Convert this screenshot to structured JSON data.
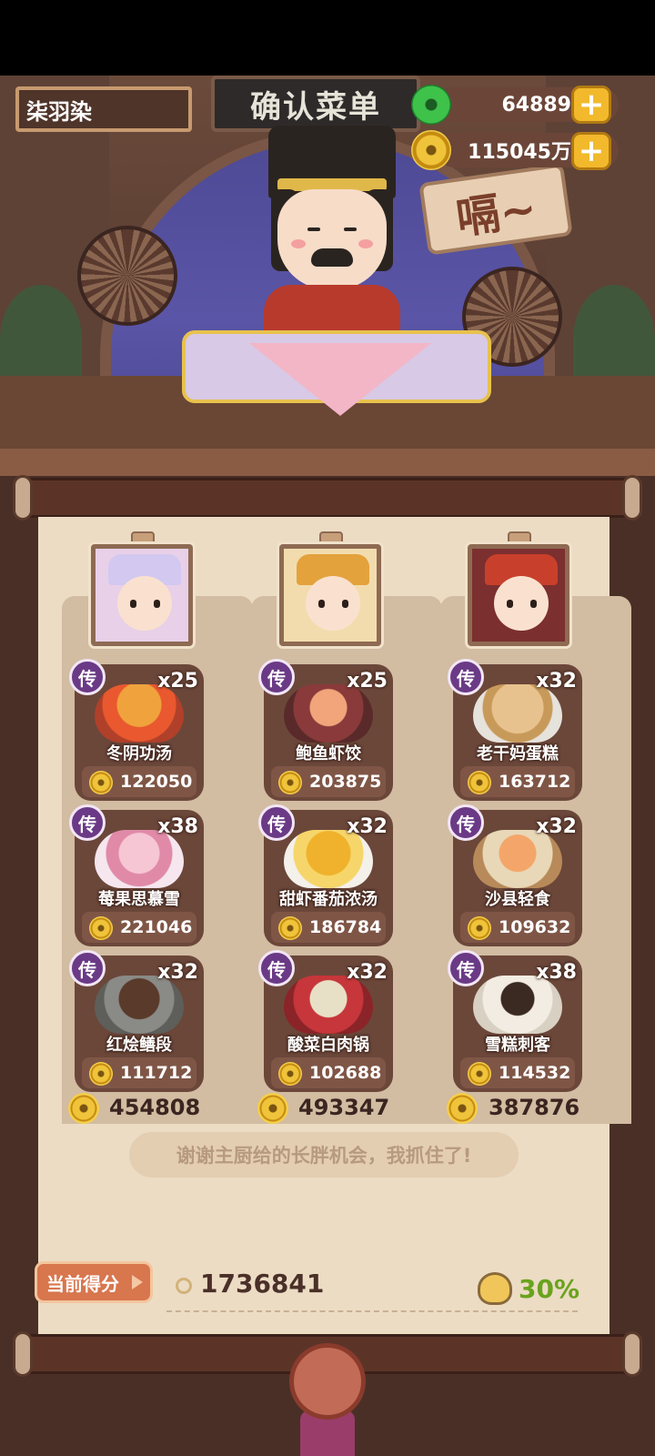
{
  "player": {
    "name": "柒羽染"
  },
  "banner": {
    "title": "确认菜单"
  },
  "speech": {
    "text": "嗝~"
  },
  "currency": {
    "jade": "64889",
    "coins": "115045万"
  },
  "columns": [
    {
      "portrait": "chef-1",
      "dishes": [
        {
          "badge": "传",
          "qty": "x25",
          "name": "冬阴功汤",
          "score": "122050"
        },
        {
          "badge": "传",
          "qty": "x38",
          "name": "莓果思慕雪",
          "score": "221046"
        },
        {
          "badge": "传",
          "qty": "x32",
          "name": "红烩鳝段",
          "score": "111712"
        }
      ],
      "total": "454808"
    },
    {
      "portrait": "chef-2",
      "dishes": [
        {
          "badge": "传",
          "qty": "x25",
          "name": "鲍鱼虾饺",
          "score": "203875"
        },
        {
          "badge": "传",
          "qty": "x32",
          "name": "甜虾番茄浓汤",
          "score": "186784"
        },
        {
          "badge": "传",
          "qty": "x32",
          "name": "酸菜白肉锅",
          "score": "102688"
        }
      ],
      "total": "493347"
    },
    {
      "portrait": "chef-3",
      "dishes": [
        {
          "badge": "传",
          "qty": "x32",
          "name": "老干妈蛋糕",
          "score": "163712"
        },
        {
          "badge": "传",
          "qty": "x32",
          "name": "沙县轻食",
          "score": "109632"
        },
        {
          "badge": "传",
          "qty": "x38",
          "name": "雪糕刺客",
          "score": "114532"
        }
      ],
      "total": "387876"
    }
  ],
  "message": "谢谢主厨给的长胖机会，我抓住了!",
  "score": {
    "label": "当前得分",
    "value": "1736841",
    "percent": "30%"
  },
  "colors": {
    "legend_badge": "#6b3a86",
    "dish_card": "#6b473a",
    "paper": "#ecdcc4",
    "percent_green": "#6aa31e"
  }
}
